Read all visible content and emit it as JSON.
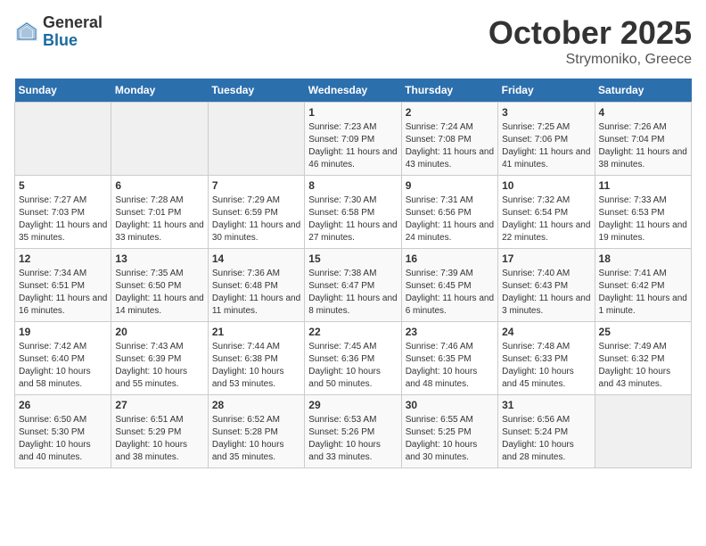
{
  "header": {
    "logo_general": "General",
    "logo_blue": "Blue",
    "month": "October 2025",
    "location": "Strymoniko, Greece"
  },
  "weekdays": [
    "Sunday",
    "Monday",
    "Tuesday",
    "Wednesday",
    "Thursday",
    "Friday",
    "Saturday"
  ],
  "weeks": [
    [
      {
        "day": "",
        "info": ""
      },
      {
        "day": "",
        "info": ""
      },
      {
        "day": "",
        "info": ""
      },
      {
        "day": "1",
        "info": "Sunrise: 7:23 AM\nSunset: 7:09 PM\nDaylight: 11 hours and 46 minutes."
      },
      {
        "day": "2",
        "info": "Sunrise: 7:24 AM\nSunset: 7:08 PM\nDaylight: 11 hours and 43 minutes."
      },
      {
        "day": "3",
        "info": "Sunrise: 7:25 AM\nSunset: 7:06 PM\nDaylight: 11 hours and 41 minutes."
      },
      {
        "day": "4",
        "info": "Sunrise: 7:26 AM\nSunset: 7:04 PM\nDaylight: 11 hours and 38 minutes."
      }
    ],
    [
      {
        "day": "5",
        "info": "Sunrise: 7:27 AM\nSunset: 7:03 PM\nDaylight: 11 hours and 35 minutes."
      },
      {
        "day": "6",
        "info": "Sunrise: 7:28 AM\nSunset: 7:01 PM\nDaylight: 11 hours and 33 minutes."
      },
      {
        "day": "7",
        "info": "Sunrise: 7:29 AM\nSunset: 6:59 PM\nDaylight: 11 hours and 30 minutes."
      },
      {
        "day": "8",
        "info": "Sunrise: 7:30 AM\nSunset: 6:58 PM\nDaylight: 11 hours and 27 minutes."
      },
      {
        "day": "9",
        "info": "Sunrise: 7:31 AM\nSunset: 6:56 PM\nDaylight: 11 hours and 24 minutes."
      },
      {
        "day": "10",
        "info": "Sunrise: 7:32 AM\nSunset: 6:54 PM\nDaylight: 11 hours and 22 minutes."
      },
      {
        "day": "11",
        "info": "Sunrise: 7:33 AM\nSunset: 6:53 PM\nDaylight: 11 hours and 19 minutes."
      }
    ],
    [
      {
        "day": "12",
        "info": "Sunrise: 7:34 AM\nSunset: 6:51 PM\nDaylight: 11 hours and 16 minutes."
      },
      {
        "day": "13",
        "info": "Sunrise: 7:35 AM\nSunset: 6:50 PM\nDaylight: 11 hours and 14 minutes."
      },
      {
        "day": "14",
        "info": "Sunrise: 7:36 AM\nSunset: 6:48 PM\nDaylight: 11 hours and 11 minutes."
      },
      {
        "day": "15",
        "info": "Sunrise: 7:38 AM\nSunset: 6:47 PM\nDaylight: 11 hours and 8 minutes."
      },
      {
        "day": "16",
        "info": "Sunrise: 7:39 AM\nSunset: 6:45 PM\nDaylight: 11 hours and 6 minutes."
      },
      {
        "day": "17",
        "info": "Sunrise: 7:40 AM\nSunset: 6:43 PM\nDaylight: 11 hours and 3 minutes."
      },
      {
        "day": "18",
        "info": "Sunrise: 7:41 AM\nSunset: 6:42 PM\nDaylight: 11 hours and 1 minute."
      }
    ],
    [
      {
        "day": "19",
        "info": "Sunrise: 7:42 AM\nSunset: 6:40 PM\nDaylight: 10 hours and 58 minutes."
      },
      {
        "day": "20",
        "info": "Sunrise: 7:43 AM\nSunset: 6:39 PM\nDaylight: 10 hours and 55 minutes."
      },
      {
        "day": "21",
        "info": "Sunrise: 7:44 AM\nSunset: 6:38 PM\nDaylight: 10 hours and 53 minutes."
      },
      {
        "day": "22",
        "info": "Sunrise: 7:45 AM\nSunset: 6:36 PM\nDaylight: 10 hours and 50 minutes."
      },
      {
        "day": "23",
        "info": "Sunrise: 7:46 AM\nSunset: 6:35 PM\nDaylight: 10 hours and 48 minutes."
      },
      {
        "day": "24",
        "info": "Sunrise: 7:48 AM\nSunset: 6:33 PM\nDaylight: 10 hours and 45 minutes."
      },
      {
        "day": "25",
        "info": "Sunrise: 7:49 AM\nSunset: 6:32 PM\nDaylight: 10 hours and 43 minutes."
      }
    ],
    [
      {
        "day": "26",
        "info": "Sunrise: 6:50 AM\nSunset: 5:30 PM\nDaylight: 10 hours and 40 minutes."
      },
      {
        "day": "27",
        "info": "Sunrise: 6:51 AM\nSunset: 5:29 PM\nDaylight: 10 hours and 38 minutes."
      },
      {
        "day": "28",
        "info": "Sunrise: 6:52 AM\nSunset: 5:28 PM\nDaylight: 10 hours and 35 minutes."
      },
      {
        "day": "29",
        "info": "Sunrise: 6:53 AM\nSunset: 5:26 PM\nDaylight: 10 hours and 33 minutes."
      },
      {
        "day": "30",
        "info": "Sunrise: 6:55 AM\nSunset: 5:25 PM\nDaylight: 10 hours and 30 minutes."
      },
      {
        "day": "31",
        "info": "Sunrise: 6:56 AM\nSunset: 5:24 PM\nDaylight: 10 hours and 28 minutes."
      },
      {
        "day": "",
        "info": ""
      }
    ]
  ]
}
